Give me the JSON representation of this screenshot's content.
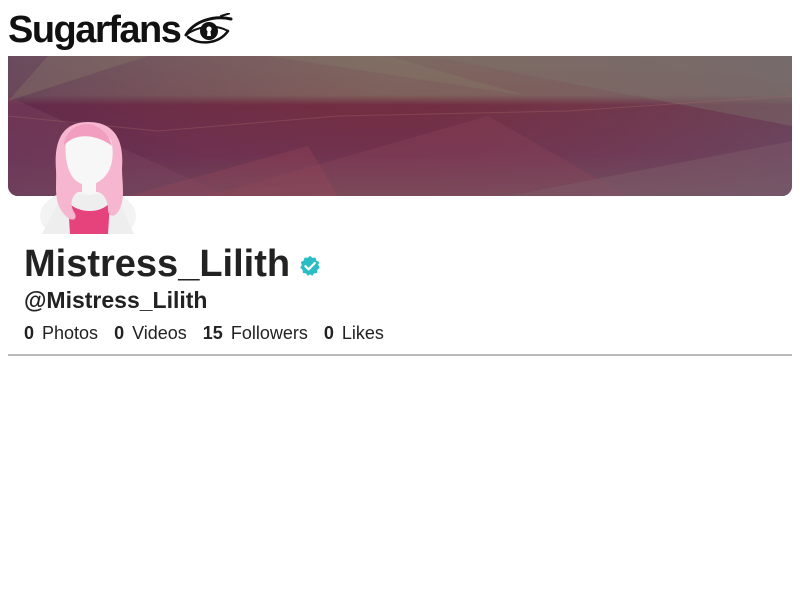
{
  "brand": {
    "name": "Sugarfans",
    "logo_icon": "eye-keyhole-icon"
  },
  "profile": {
    "display_name": "Mistress_Lilith",
    "handle": "@Mistress_Lilith",
    "verified": true,
    "verified_icon": "verified-check-icon",
    "avatar_icon": "female-avatar-placeholder-icon"
  },
  "stats": [
    {
      "count": "0",
      "label": "Photos"
    },
    {
      "count": "0",
      "label": "Videos"
    },
    {
      "count": "15",
      "label": "Followers"
    },
    {
      "count": "0",
      "label": "Likes"
    }
  ],
  "colors": {
    "verified": "#2bbcc4",
    "avatar_hair": "#f7b6cf",
    "avatar_body": "#e6437c",
    "cover_base": "#6f4a58",
    "text": "#222222",
    "divider": "#b9b9b9"
  }
}
